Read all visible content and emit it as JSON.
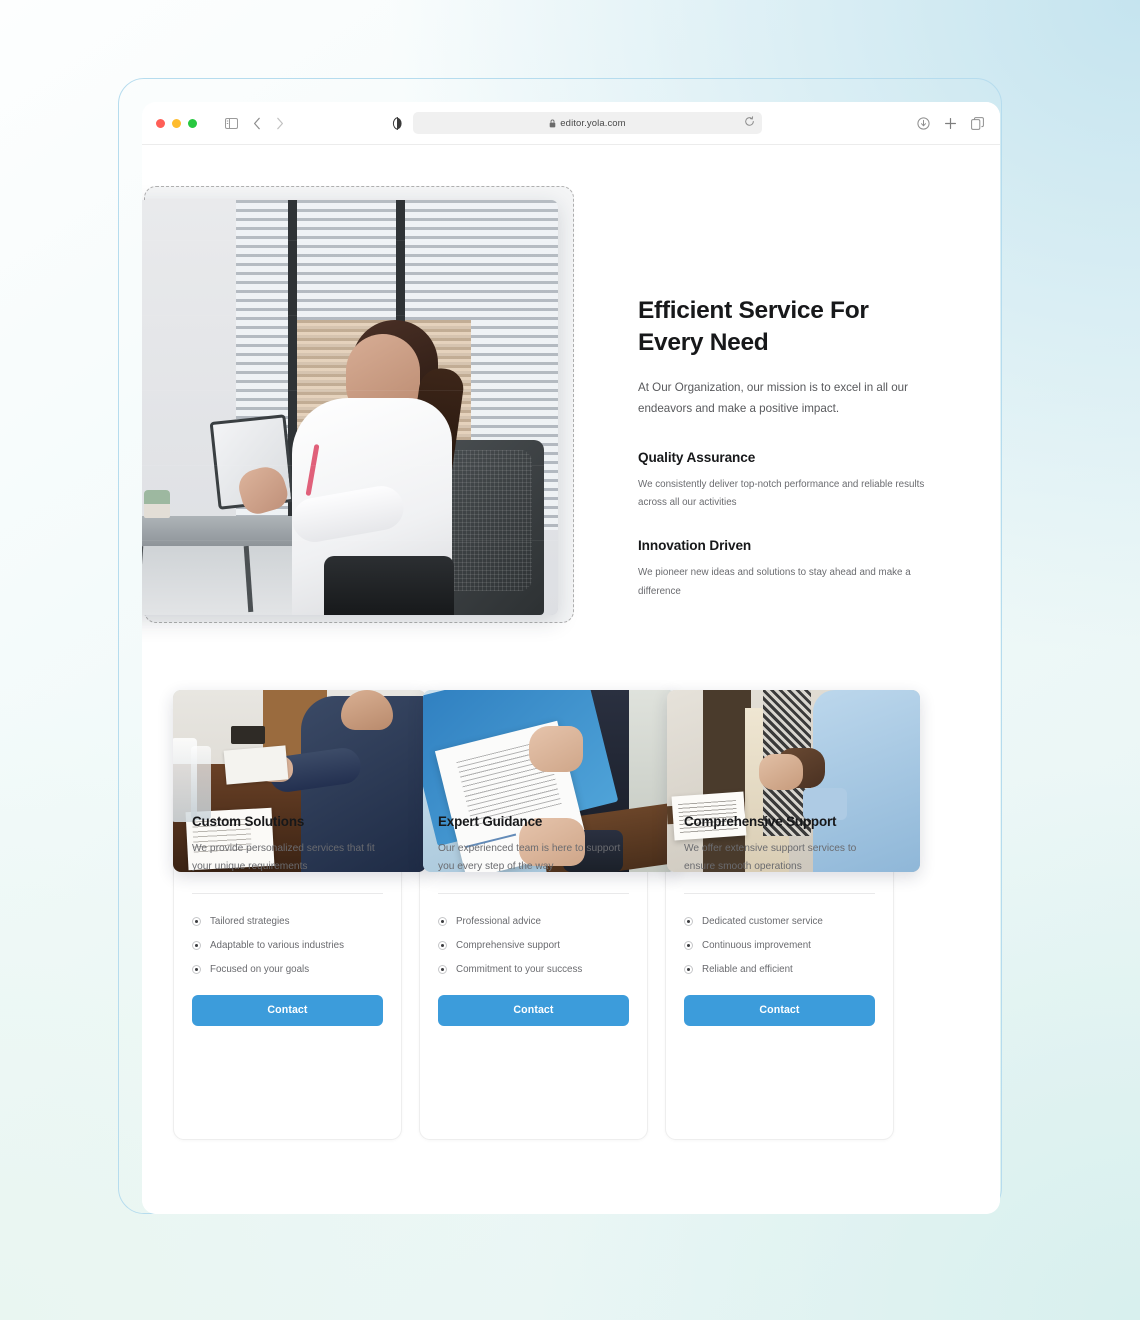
{
  "browser": {
    "url": "editor.yola.com",
    "lock_icon": "lock-icon",
    "reload_icon": "reload-icon",
    "sidebar_icon": "sidebar-toggle-icon",
    "back_icon": "chevron-left-icon",
    "forward_icon": "chevron-right-icon",
    "reader_icon": "reader-mode-icon",
    "download_icon": "download-icon",
    "newtab_icon": "plus-icon",
    "tabs_icon": "tab-overview-icon",
    "traffic": [
      "close-button",
      "minimize-button",
      "maximize-button"
    ]
  },
  "hero": {
    "title": "Efficient Service For Every Need",
    "subtitle": "At Our Organization, our mission is to excel in all our endeavors and make a positive impact.",
    "features": [
      {
        "title": "Quality Assurance",
        "desc": "We consistently deliver top-notch performance and reliable results across all our activities"
      },
      {
        "title": "Innovation Driven",
        "desc": "We pioneer new ideas and solutions to stay ahead and make a difference"
      }
    ],
    "image_alt": "woman-at-desk-with-tablet-photo"
  },
  "cards": [
    {
      "image_alt": "man-writing-document-at-desk-photo",
      "title": "Custom Solutions",
      "desc": "We provide personalized services that fit your unique requirements",
      "items": [
        "Tailored strategies",
        "Adaptable to various industries",
        "Focused on your goals"
      ],
      "button": "Contact"
    },
    {
      "image_alt": "hands-exchanging-signed-contract-photo",
      "title": "Expert Guidance",
      "desc": "Our experienced team is here to support you every step of the way",
      "items": [
        "Professional advice",
        "Comprehensive support",
        "Commitment to your success"
      ],
      "button": "Contact"
    },
    {
      "image_alt": "business-handshake-photo",
      "title": "Comprehensive Support",
      "desc": "We offer extensive support services to ensure smooth operations",
      "items": [
        "Dedicated customer service",
        "Continuous improvement",
        "Reliable and efficient"
      ],
      "button": "Contact"
    }
  ],
  "colors": {
    "accent_button": "#3c9cdb",
    "frame_border": "#b6dcee",
    "selection_dash": "#b0b0b0",
    "heading_text": "#17181a",
    "body_text": "#6a6b6f"
  }
}
